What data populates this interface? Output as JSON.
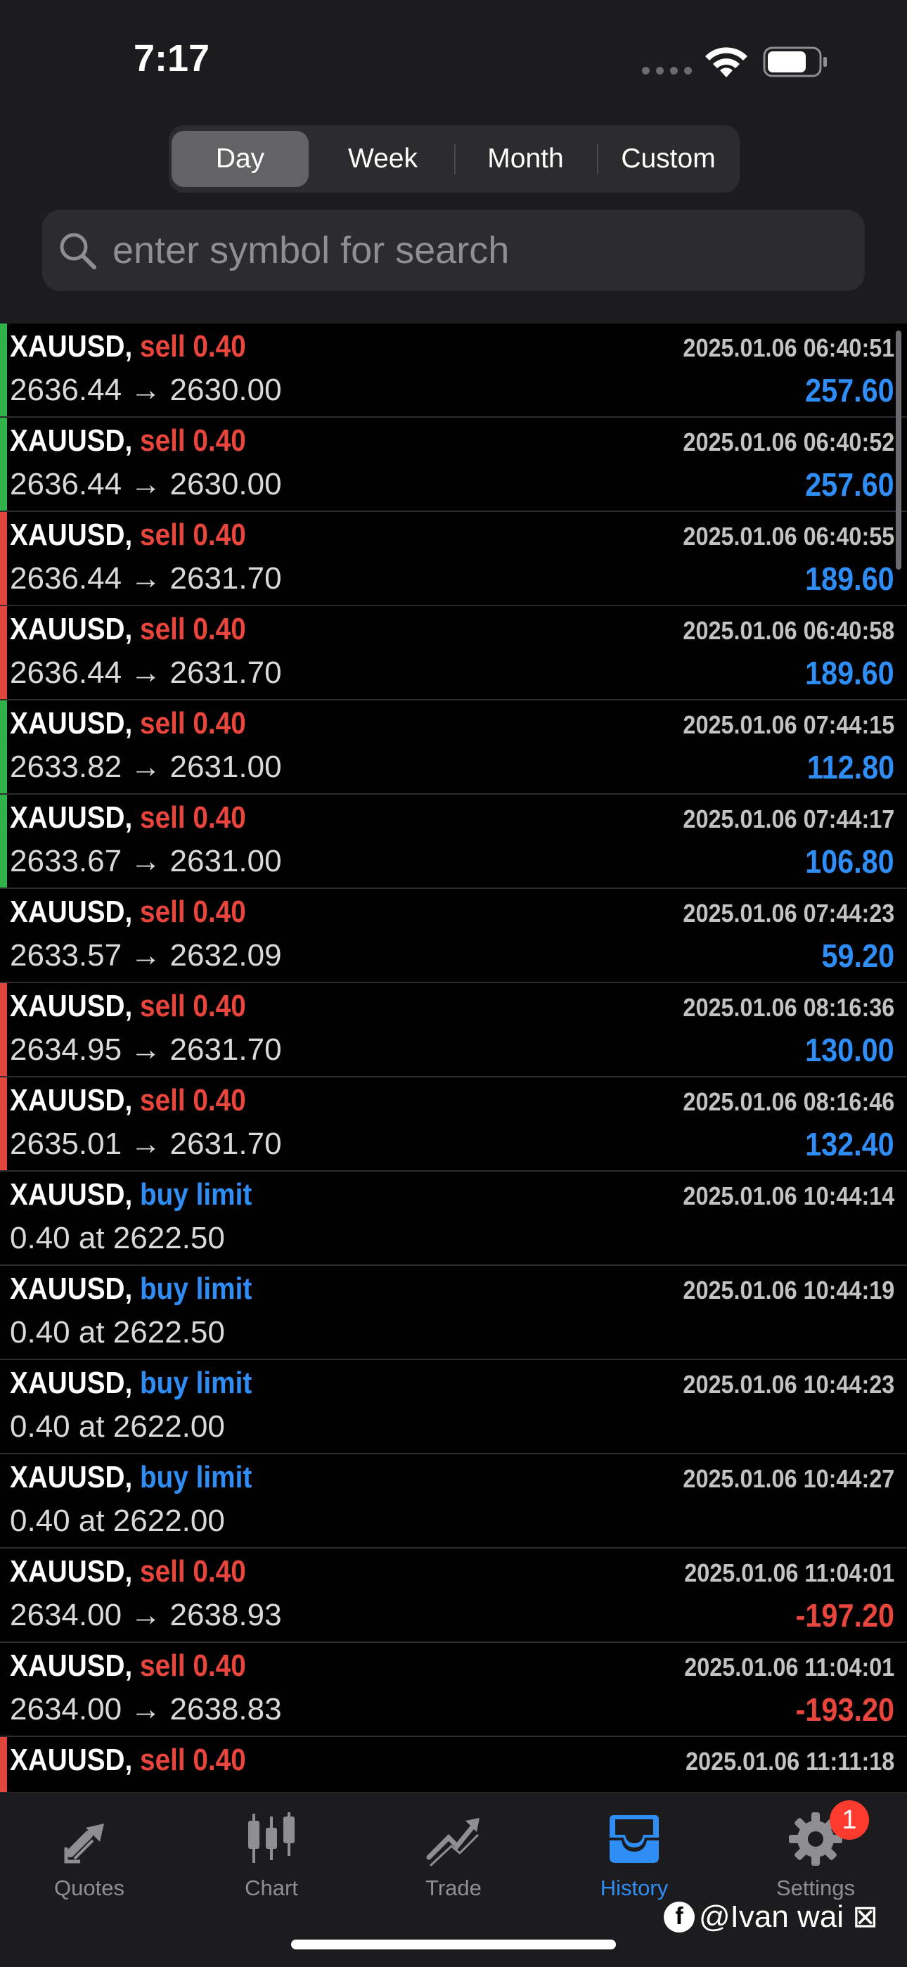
{
  "status_bar": {
    "time": "7:17"
  },
  "periods": {
    "selected": "Day",
    "items": [
      "Day",
      "Week",
      "Month",
      "Custom"
    ]
  },
  "search": {
    "placeholder": "enter symbol for search"
  },
  "history": [
    {
      "symbol": "XAUUSD,",
      "action": "sell 0.40",
      "type": "sell",
      "detail": "2636.44 → 2630.00",
      "time": "2025.01.06 06:40:51",
      "profit": "257.60",
      "accent": "green"
    },
    {
      "symbol": "XAUUSD,",
      "action": "sell 0.40",
      "type": "sell",
      "detail": "2636.44 → 2630.00",
      "time": "2025.01.06 06:40:52",
      "profit": "257.60",
      "accent": "green"
    },
    {
      "symbol": "XAUUSD,",
      "action": "sell 0.40",
      "type": "sell",
      "detail": "2636.44 → 2631.70",
      "time": "2025.01.06 06:40:55",
      "profit": "189.60",
      "accent": "red"
    },
    {
      "symbol": "XAUUSD,",
      "action": "sell 0.40",
      "type": "sell",
      "detail": "2636.44 → 2631.70",
      "time": "2025.01.06 06:40:58",
      "profit": "189.60",
      "accent": "red"
    },
    {
      "symbol": "XAUUSD,",
      "action": "sell 0.40",
      "type": "sell",
      "detail": "2633.82 → 2631.00",
      "time": "2025.01.06 07:44:15",
      "profit": "112.80",
      "accent": "green"
    },
    {
      "symbol": "XAUUSD,",
      "action": "sell 0.40",
      "type": "sell",
      "detail": "2633.67 → 2631.00",
      "time": "2025.01.06 07:44:17",
      "profit": "106.80",
      "accent": "green"
    },
    {
      "symbol": "XAUUSD,",
      "action": "sell 0.40",
      "type": "sell",
      "detail": "2633.57 → 2632.09",
      "time": "2025.01.06 07:44:23",
      "profit": "59.20",
      "accent": "none"
    },
    {
      "symbol": "XAUUSD,",
      "action": "sell 0.40",
      "type": "sell",
      "detail": "2634.95 → 2631.70",
      "time": "2025.01.06 08:16:36",
      "profit": "130.00",
      "accent": "red"
    },
    {
      "symbol": "XAUUSD,",
      "action": "sell 0.40",
      "type": "sell",
      "detail": "2635.01 → 2631.70",
      "time": "2025.01.06 08:16:46",
      "profit": "132.40",
      "accent": "red"
    },
    {
      "symbol": "XAUUSD,",
      "action": "buy limit",
      "type": "buy",
      "detail": "0.40 at 2622.50",
      "time": "2025.01.06 10:44:14",
      "profit": "",
      "accent": "none"
    },
    {
      "symbol": "XAUUSD,",
      "action": "buy limit",
      "type": "buy",
      "detail": "0.40 at 2622.50",
      "time": "2025.01.06 10:44:19",
      "profit": "",
      "accent": "none"
    },
    {
      "symbol": "XAUUSD,",
      "action": "buy limit",
      "type": "buy",
      "detail": "0.40 at 2622.00",
      "time": "2025.01.06 10:44:23",
      "profit": "",
      "accent": "none"
    },
    {
      "symbol": "XAUUSD,",
      "action": "buy limit",
      "type": "buy",
      "detail": "0.40 at 2622.00",
      "time": "2025.01.06 10:44:27",
      "profit": "",
      "accent": "none"
    },
    {
      "symbol": "XAUUSD,",
      "action": "sell 0.40",
      "type": "sell",
      "detail": "2634.00 → 2638.93",
      "time": "2025.01.06 11:04:01",
      "profit": "-197.20",
      "accent": "none"
    },
    {
      "symbol": "XAUUSD,",
      "action": "sell 0.40",
      "type": "sell",
      "detail": "2634.00 → 2638.83",
      "time": "2025.01.06 11:04:01",
      "profit": "-193.20",
      "accent": "none"
    },
    {
      "symbol": "XAUUSD,",
      "action": "sell 0.40",
      "type": "sell",
      "detail": "",
      "time": "2025.01.06 11:11:18",
      "profit": "",
      "accent": "red"
    }
  ],
  "tabs": [
    {
      "label": "Quotes",
      "icon": "quotes-icon"
    },
    {
      "label": "Chart",
      "icon": "chart-icon"
    },
    {
      "label": "Trade",
      "icon": "trade-icon"
    },
    {
      "label": "History",
      "icon": "history-icon",
      "active": true
    },
    {
      "label": "Settings",
      "icon": "settings-icon"
    }
  ],
  "settings_badge": "1",
  "watermark": {
    "logo": "f",
    "text": "@Ivan wai ⊠"
  },
  "colors": {
    "sell": "#e8453c",
    "buy": "#2f8df6",
    "profit_positive": "#2f8df6",
    "profit_negative": "#e8453c",
    "active_tab": "#2f8df6"
  }
}
